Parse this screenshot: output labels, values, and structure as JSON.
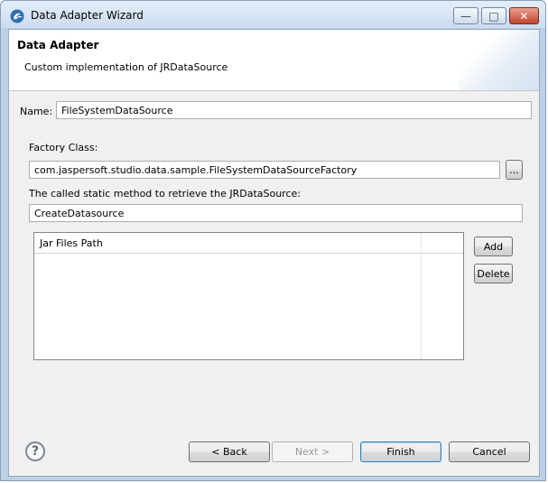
{
  "window": {
    "title": "Data Adapter Wizard"
  },
  "header": {
    "title": "Data Adapter",
    "description": "Custom implementation of JRDataSource"
  },
  "form": {
    "name_label": "Name:",
    "name_value": "FileSystemDataSource",
    "factory_label": "Factory Class:",
    "factory_value": "com.jaspersoft.studio.data.sample.FileSystemDataSourceFactory",
    "browse_label": "...",
    "method_label": "The called static method to retrieve the JRDataSource:",
    "method_value": "CreateDatasource"
  },
  "jar_table": {
    "columns": [
      "Jar Files Path",
      ""
    ],
    "rows": [],
    "add_label": "Add",
    "delete_label": "Delete"
  },
  "footer": {
    "back_label": "< Back",
    "next_label": "Next >",
    "finish_label": "Finish",
    "cancel_label": "Cancel"
  },
  "icons": {
    "app": "jaspersoft-logo-icon",
    "help": "help-icon",
    "minimize": "minimize-icon",
    "maximize": "maximize-icon",
    "close": "close-icon"
  },
  "colors": {
    "title_bar": "#cbdcf0",
    "client_bg": "#f0f0f0",
    "close_button": "#c2432a"
  }
}
